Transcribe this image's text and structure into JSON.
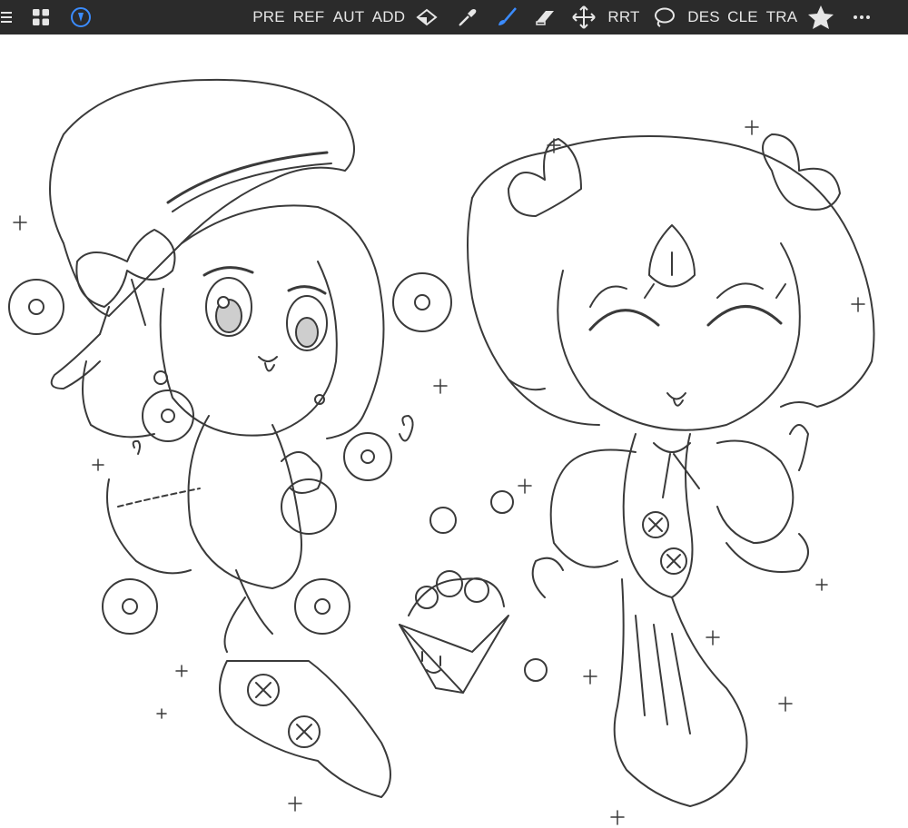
{
  "toolbar": {
    "left_icons": [
      "menu-icon",
      "grid-icon",
      "brand-icon"
    ],
    "labels": {
      "pre": "PRE",
      "ref": "REF",
      "aut": "AUT",
      "add": "ADD",
      "rrt": "RRT",
      "des": "DES",
      "cle": "CLE",
      "tra": "TRA"
    },
    "active_tool": "brush",
    "accent": "#3b8cff",
    "icons": [
      "selection-icon",
      "eyedropper-icon",
      "brush-icon",
      "eraser-icon",
      "move-icon",
      "lasso-icon",
      "star-icon",
      "more-icon"
    ]
  },
  "canvas": {
    "content": "pencil sketch of two chibi characters with flowers and popcorn",
    "background": "#ffffff",
    "line_color": "#3a3a3a"
  }
}
